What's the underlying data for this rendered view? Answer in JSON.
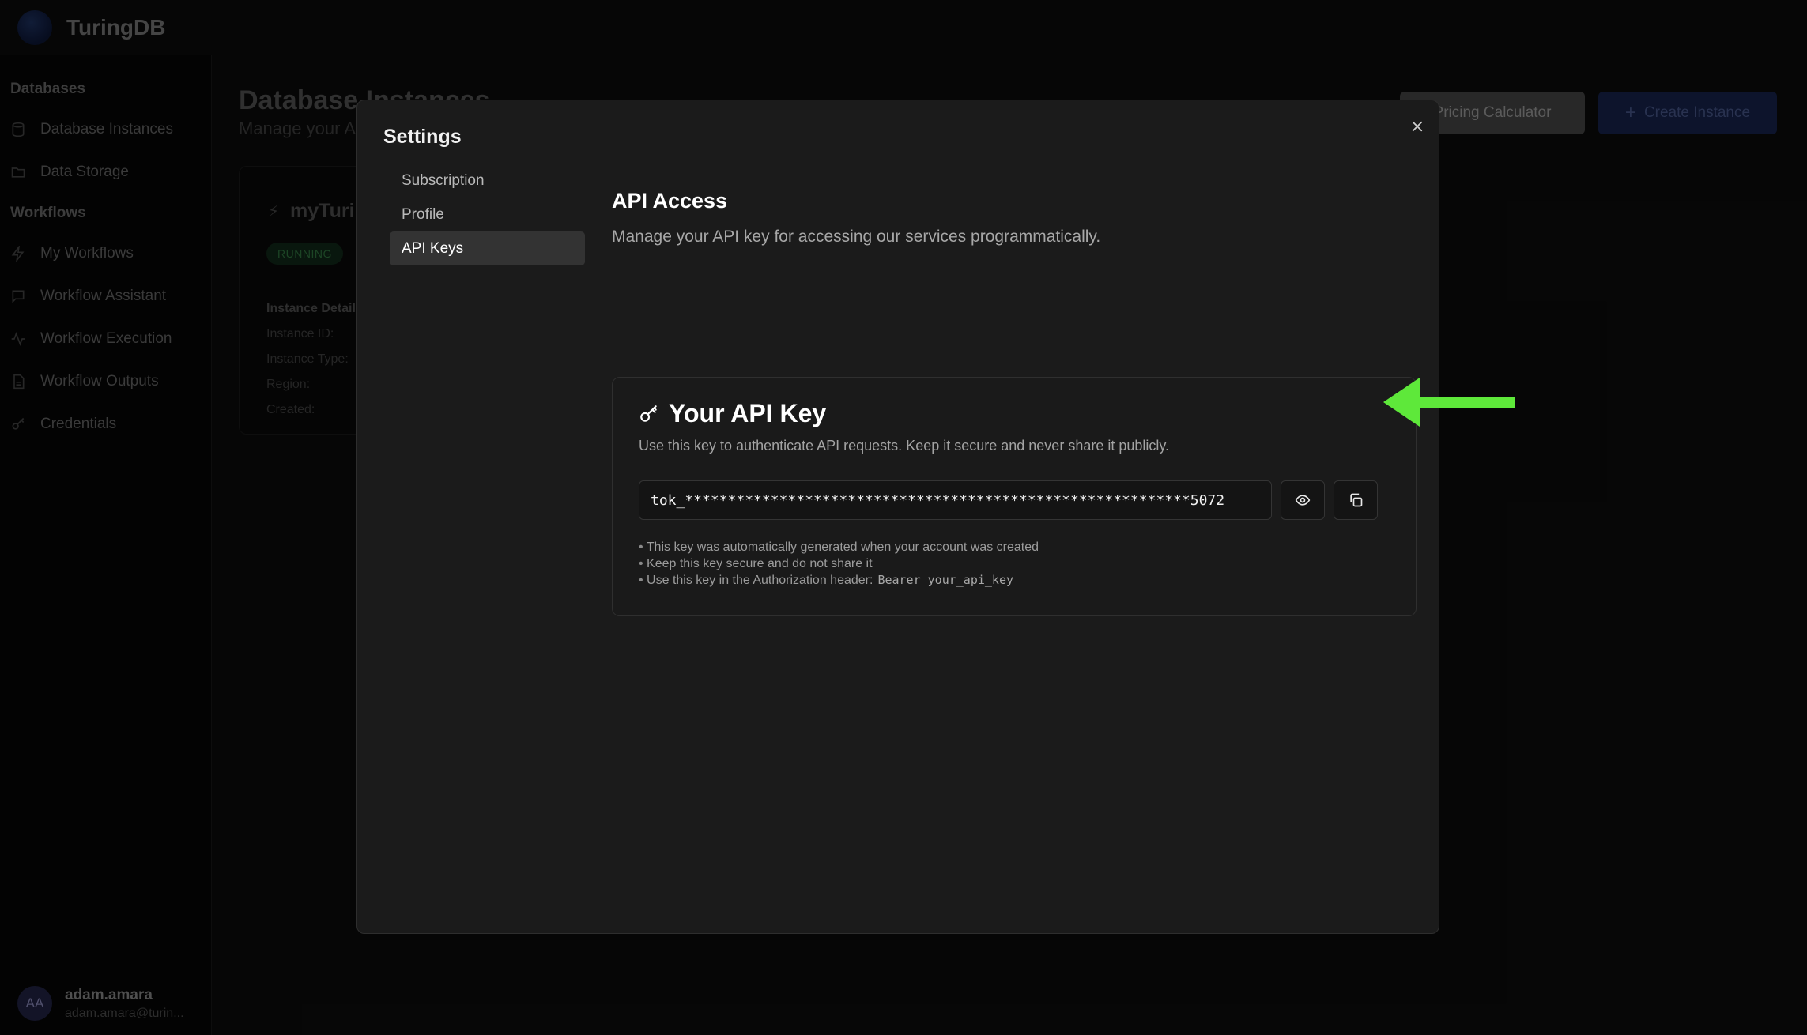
{
  "app": {
    "brand": "TuringDB",
    "accent_arrow": "#5ee83a"
  },
  "sidebar": {
    "sections": [
      {
        "title": "Databases",
        "items": [
          {
            "label": "Database Instances",
            "icon": "database-icon"
          },
          {
            "label": "Data Storage",
            "icon": "folder-icon"
          }
        ]
      },
      {
        "title": "Workflows",
        "items": [
          {
            "label": "My Workflows",
            "icon": "zap-icon"
          },
          {
            "label": "Workflow Assistant",
            "icon": "message-icon"
          },
          {
            "label": "Workflow Execution",
            "icon": "activity-icon"
          },
          {
            "label": "Workflow Outputs",
            "icon": "file-icon"
          },
          {
            "label": "Credentials",
            "icon": "key-icon"
          }
        ]
      }
    ],
    "user": {
      "initials": "AA",
      "name": "adam.amara",
      "email": "adam.amara@turin..."
    }
  },
  "main": {
    "title": "Database Instances",
    "subtitle": "Manage your A",
    "pricing_button": "Pricing Calculator",
    "create_button": "Create Instance",
    "card": {
      "name": "myTuri",
      "status": "RUNNING",
      "details_header": "Instance Detail",
      "fields": [
        "Instance ID:",
        "Instance Type:",
        "Region:",
        "Created:"
      ]
    }
  },
  "modal": {
    "title": "Settings",
    "nav": [
      {
        "label": "Subscription",
        "active": false
      },
      {
        "label": "Profile",
        "active": false
      },
      {
        "label": "API Keys",
        "active": true
      }
    ],
    "section_title": "API Access",
    "section_desc": "Manage your API key for accessing our services programmatically.",
    "key_card": {
      "title": "Your API Key",
      "description": "Use this key to authenticate API requests. Keep it secure and never share it publicly.",
      "masked_key": "tok_***********************************************************5072",
      "notes": [
        "This key was automatically generated when your account was created",
        "Keep this key secure and do not share it",
        "Use this key in the Authorization header:"
      ],
      "header_example": "Bearer your_api_key"
    }
  }
}
